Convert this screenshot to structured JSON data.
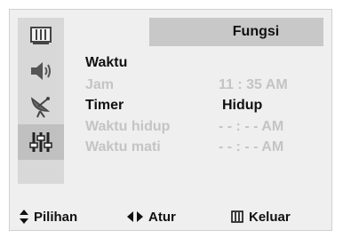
{
  "menu": {
    "title": "Fungsi",
    "sidebar": [
      {
        "icon": "picture-icon",
        "active": false
      },
      {
        "icon": "speaker-icon",
        "active": false
      },
      {
        "icon": "satellite-dish-icon",
        "active": false
      },
      {
        "icon": "settings-sliders-icon",
        "active": true
      }
    ],
    "rows": [
      {
        "label": "Waktu",
        "value": "",
        "enabled": true
      },
      {
        "label": "Jam",
        "value": "11 : 35  AM",
        "enabled": false
      },
      {
        "label": "Timer",
        "value": "Hidup",
        "enabled": true
      },
      {
        "label": "Waktu hidup",
        "value": "- - : - -  AM",
        "enabled": false
      },
      {
        "label": "Waktu mati",
        "value": "- - : - -  AM",
        "enabled": false
      }
    ]
  },
  "footer": {
    "select_label": "Pilihan",
    "adjust_label": "Atur",
    "exit_label": "Keluar"
  }
}
